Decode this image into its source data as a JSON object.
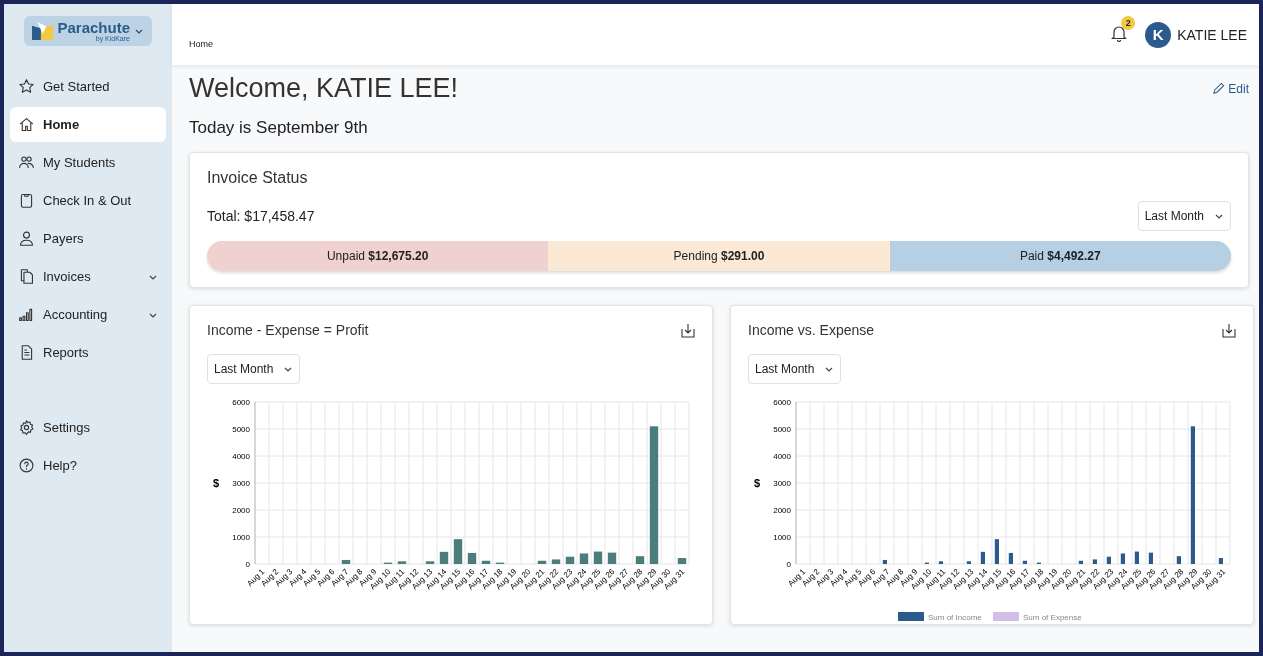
{
  "sidebar": {
    "logo": {
      "name": "Parachute",
      "tagline": "by KidKare"
    },
    "items": [
      {
        "label": "Get Started",
        "selected": false,
        "expandable": false
      },
      {
        "label": "Home",
        "selected": true,
        "expandable": false
      },
      {
        "label": "My Students",
        "selected": false,
        "expandable": false
      },
      {
        "label": "Check In & Out",
        "selected": false,
        "expandable": false
      },
      {
        "label": "Payers",
        "selected": false,
        "expandable": false
      },
      {
        "label": "Invoices",
        "selected": false,
        "expandable": true
      },
      {
        "label": "Accounting",
        "selected": false,
        "expandable": true
      },
      {
        "label": "Reports",
        "selected": false,
        "expandable": false
      }
    ],
    "bottom_items": [
      {
        "label": "Settings",
        "selected": false
      },
      {
        "label": "Help?",
        "selected": false
      }
    ]
  },
  "header": {
    "breadcrumb": "Home",
    "notifications": "2",
    "avatar_initial": "K",
    "user_name": "KATIE LEE"
  },
  "welcome": {
    "title": "Welcome, KATIE LEE!",
    "edit": "Edit",
    "date": "Today is September 9th"
  },
  "invoice_status": {
    "title": "Invoice Status",
    "total": "Total: $17,458.47",
    "period": "Last Month",
    "segments": [
      {
        "label": "Unpaid **$12,675.20**",
        "color": "#efd1d0"
      },
      {
        "label": "Pending **$291.00**",
        "color": "#fbe9d6"
      },
      {
        "label": "Paid **$4,492.27**",
        "color": "#b6cfe2"
      }
    ]
  },
  "charts": [
    {
      "title": "Income - Expense = Profit",
      "period": "Last Month",
      "chart_data": {
        "type": "bar",
        "ylabel": "$",
        "categories": [
          "Aug 1",
          "Aug 2",
          "Aug 3",
          "Aug 4",
          "Aug 5",
          "Aug 6",
          "Aug 7",
          "Aug 8",
          "Aug 9",
          "Aug 10",
          "Aug 11",
          "Aug 12",
          "Aug 13",
          "Aug 14",
          "Aug 15",
          "Aug 16",
          "Aug 17",
          "Aug 18",
          "Aug 19",
          "Aug 20",
          "Aug 21",
          "Aug 22",
          "Aug 23",
          "Aug 24",
          "Aug 25",
          "Aug 26",
          "Aug 27",
          "Aug 28",
          "Aug 29",
          "Aug 30",
          "Aug 31"
        ],
        "grid": true,
        "series": [
          {
            "color": "#4a7d7c",
            "values": [
              0,
              0,
              0,
              0,
              0,
              0,
              150,
              0,
              0,
              50,
              100,
              0,
              100,
              450,
              920,
              410,
              120,
              50,
              0,
              0,
              120,
              170,
              270,
              390,
              460,
              420,
              0,
              290,
              5100,
              0,
              220
            ]
          }
        ],
        "ylim": [
          0,
          6000
        ],
        "yticks": [
          0,
          1000,
          2000,
          3000,
          4000,
          5000,
          6000
        ]
      }
    },
    {
      "title": "Income vs. Expense",
      "period": "Last Month",
      "chart_data": {
        "type": "bar",
        "ylabel": "$",
        "categories": [
          "Aug 1",
          "Aug 2",
          "Aug 3",
          "Aug 4",
          "Aug 5",
          "Aug 6",
          "Aug 7",
          "Aug 8",
          "Aug 9",
          "Aug 10",
          "Aug 11",
          "Aug 12",
          "Aug 13",
          "Aug 14",
          "Aug 15",
          "Aug 16",
          "Aug 17",
          "Aug 18",
          "Aug 19",
          "Aug 20",
          "Aug 21",
          "Aug 22",
          "Aug 23",
          "Aug 24",
          "Aug 25",
          "Aug 26",
          "Aug 27",
          "Aug 28",
          "Aug 29",
          "Aug 30",
          "Aug 31"
        ],
        "grid": true,
        "series": [
          {
            "name": "Sum of Income",
            "color": "#2b5b8c",
            "values": [
              0,
              0,
              0,
              0,
              0,
              0,
              150,
              0,
              0,
              50,
              100,
              0,
              100,
              450,
              920,
              410,
              120,
              50,
              0,
              0,
              120,
              170,
              270,
              390,
              460,
              420,
              0,
              290,
              5100,
              0,
              220
            ]
          },
          {
            "name": "Sum of Expense",
            "color": "#d2bfe6",
            "values": [
              0,
              0,
              0,
              0,
              0,
              0,
              0,
              0,
              0,
              0,
              0,
              0,
              0,
              0,
              0,
              0,
              0,
              0,
              0,
              0,
              0,
              0,
              0,
              0,
              0,
              0,
              0,
              0,
              0,
              0,
              0
            ]
          }
        ],
        "ylim": [
          0,
          6000
        ],
        "yticks": [
          0,
          1000,
          2000,
          3000,
          4000,
          5000,
          6000
        ]
      }
    }
  ]
}
